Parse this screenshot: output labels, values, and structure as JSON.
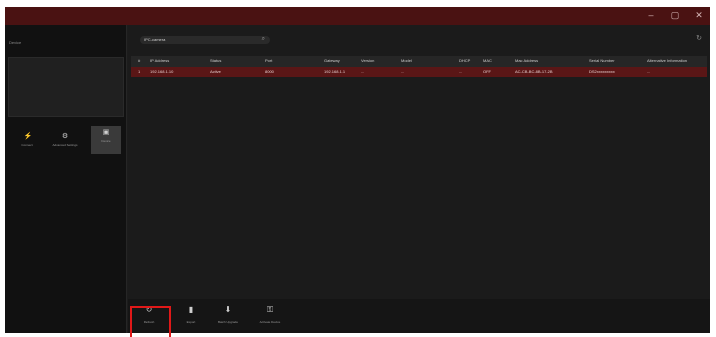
{
  "window": {
    "controls": {
      "minimize": "–",
      "maximize": "▢",
      "close": "✕"
    }
  },
  "left_panel": {
    "title": "Device",
    "tools": [
      {
        "label": "Connect",
        "icon": "plug-icon"
      },
      {
        "label": "Advanced Settings",
        "icon": "gear-icon"
      },
      {
        "label": "Device",
        "icon": "device-icon"
      }
    ]
  },
  "search": {
    "value": "IPC-camera",
    "icon": "search-icon"
  },
  "table": {
    "columns": [
      "#",
      "IP Address",
      "Status",
      "Port",
      "Gateway",
      "Version",
      "Model",
      "DHCP",
      "MAC",
      "Mac Address",
      "Serial Number",
      "Alternative Information"
    ],
    "rows": [
      {
        "cells": [
          "1",
          "192.168.1.10",
          "Active",
          "8000",
          "192.168.1.1",
          "...",
          "...",
          "...",
          "OFF",
          "AC-CB-BC-8B-17-2B",
          "DS2xxxxxxxxx",
          "..."
        ]
      }
    ]
  },
  "bottom_toolbar": {
    "items": [
      {
        "label": "Refresh",
        "icon": "refresh-icon"
      },
      {
        "label": "Export",
        "icon": "export-icon"
      },
      {
        "label": "Batch Upgrade",
        "icon": "download-icon"
      },
      {
        "label": "Activate Device",
        "icon": "lock-icon"
      }
    ]
  },
  "colors": {
    "title_bar": "#4a1212",
    "selected_row": "#5a1616",
    "highlight_box": "#e01818"
  }
}
